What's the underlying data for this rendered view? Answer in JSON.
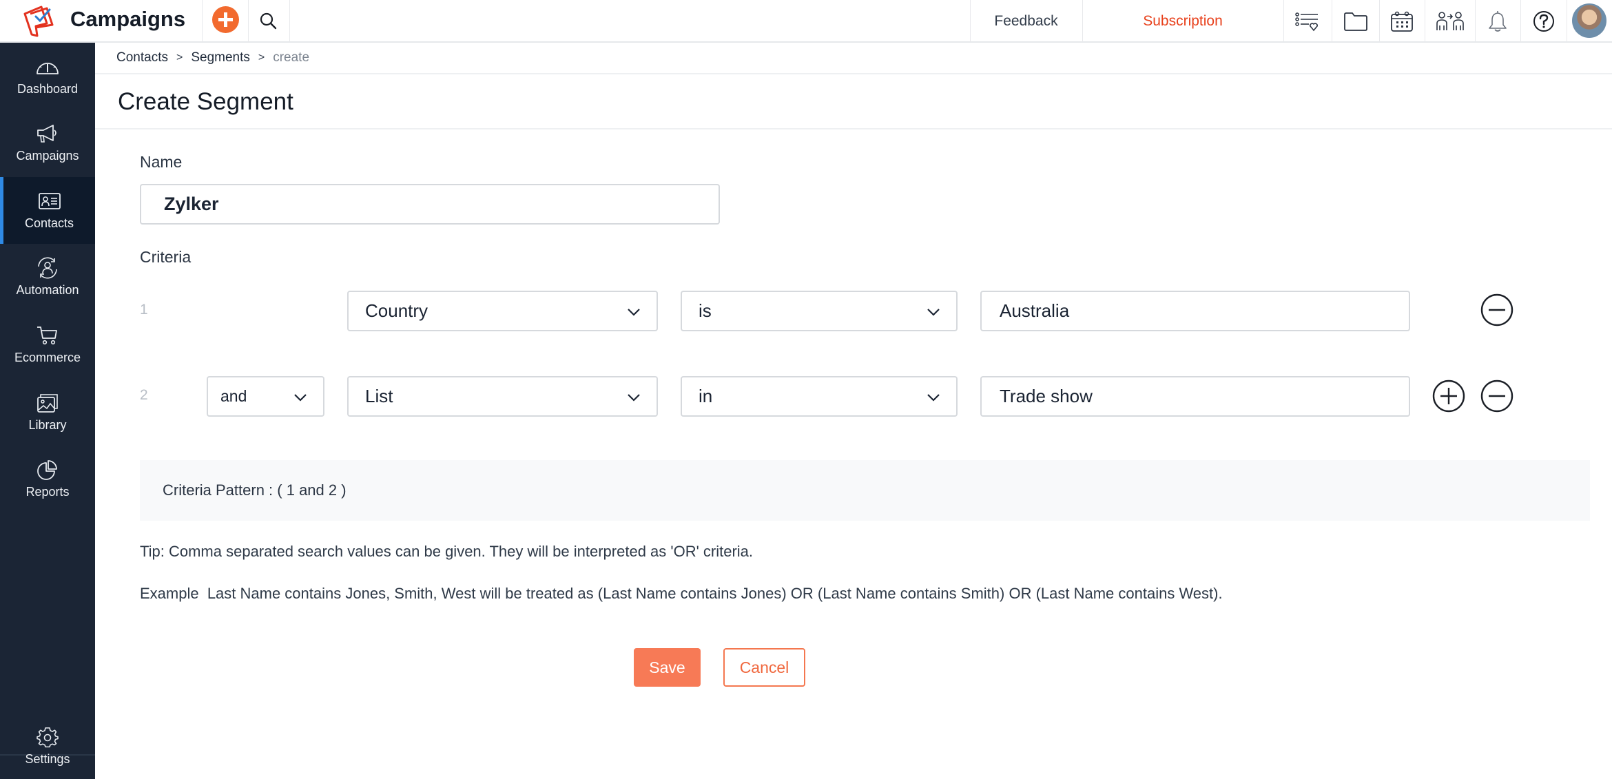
{
  "header": {
    "app_title": "Campaigns",
    "feedback_label": "Feedback",
    "subscription_label": "Subscription",
    "icons": [
      "add-icon",
      "search-icon",
      "signup-forms-icon",
      "folder-icon",
      "calendar-icon",
      "contact-transfer-icon",
      "bell-icon",
      "help-icon",
      "avatar"
    ],
    "accent_color": "#f26a2e",
    "subscription_color": "#e8411c"
  },
  "sidebar": {
    "items": [
      {
        "label": "Dashboard",
        "icon": "dashboard-icon"
      },
      {
        "label": "Campaigns",
        "icon": "megaphone-icon"
      },
      {
        "label": "Contacts",
        "icon": "contact-card-icon",
        "active": true
      },
      {
        "label": "Automation",
        "icon": "automation-icon"
      },
      {
        "label": "Ecommerce",
        "icon": "cart-icon"
      },
      {
        "label": "Library",
        "icon": "image-library-icon"
      },
      {
        "label": "Reports",
        "icon": "pie-chart-icon"
      }
    ],
    "settings_label": "Settings",
    "active_color": "#2f8ae5"
  },
  "breadcrumb": {
    "items": [
      "Contacts",
      "Segments"
    ],
    "current": "create"
  },
  "page": {
    "title": "Create Segment",
    "name_label": "Name",
    "name_value": "Zylker",
    "criteria_label": "Criteria",
    "criteria": [
      {
        "number": "1",
        "field": "Country",
        "operator": "is",
        "value": "Australia"
      },
      {
        "number": "2",
        "connector": "and",
        "field": "List",
        "operator": "in",
        "value": "Trade show"
      }
    ],
    "pattern_text": "Criteria Pattern : ( 1 and 2 )",
    "tip_text": "Tip: Comma separated search values can be given. They will be interpreted as 'OR' criteria.",
    "example_text": "Example  Last Name contains Jones, Smith, West will be treated as (Last Name contains Jones) OR (Last Name contains Smith) OR (Last Name contains West).",
    "save_label": "Save",
    "cancel_label": "Cancel"
  }
}
